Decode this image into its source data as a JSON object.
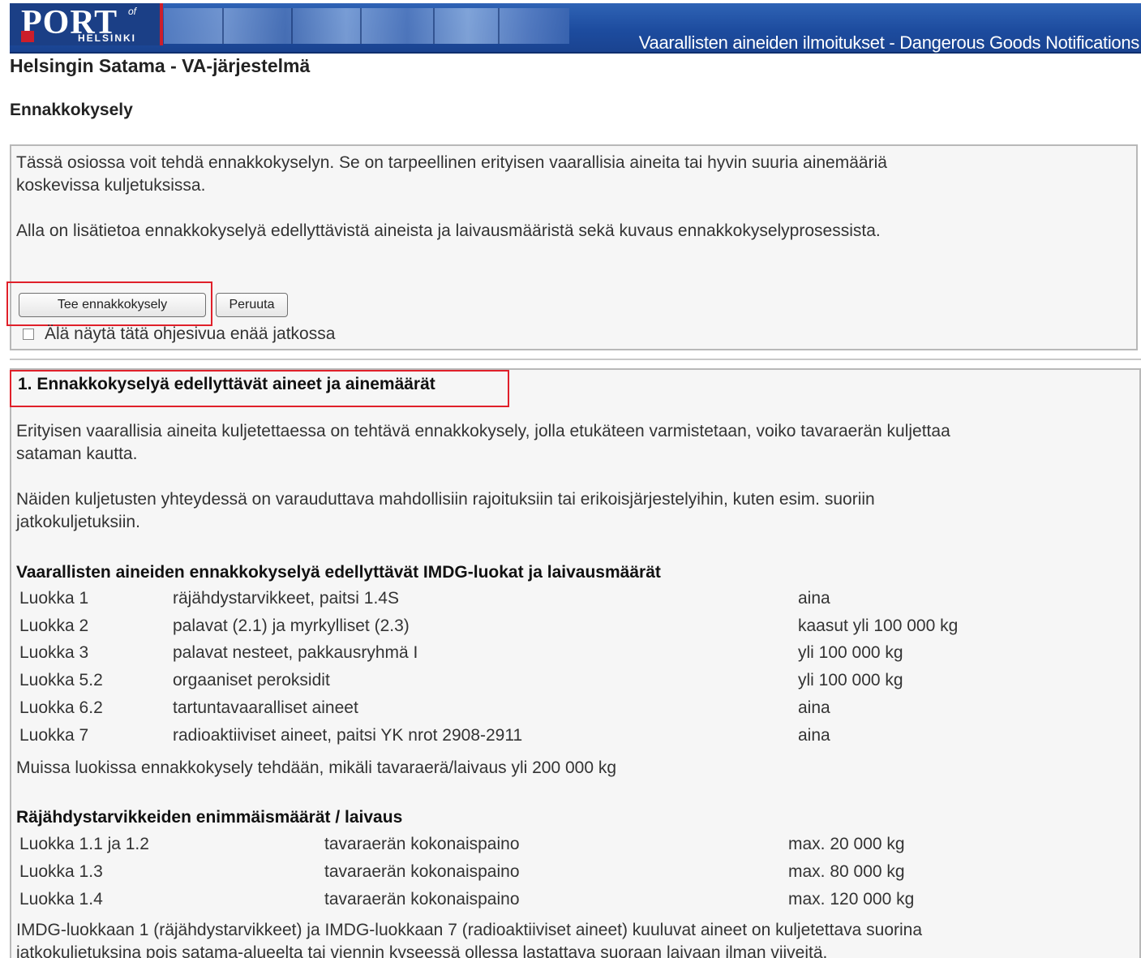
{
  "header": {
    "logo_main": "PORT",
    "logo_of": "of",
    "logo_city": "HELSINKI",
    "title": "Vaarallisten aineiden ilmoitukset - Dangerous Goods Notifications"
  },
  "app_title": "Helsingin Satama - VA-järjestelmä",
  "page_title": "Ennakkokysely",
  "intro": {
    "para1_line1": "Tässä osiossa voit tehdä ennakkokyselyn. Se on tarpeellinen erityisen vaarallisia aineita tai hyvin suuria ainemääriä",
    "para1_line2": "koskevissa kuljetuksissa.",
    "para2": "Alla on lisätietoa ennakkokyselyä edellyttävistä aineista ja laivausmääristä sekä kuvaus ennakkokyselyprosessista.",
    "submit_label": "Tee ennakkokysely",
    "cancel_label": "Peruuta",
    "checkbox_label": "Älä näytä tätä ohjesivua enää jatkossa",
    "checkbox_checked": false
  },
  "section1": {
    "heading": "1. Ennakkokyselyä edellyttävät aineet ja ainemäärät",
    "para1_line1": "Erityisen vaarallisia aineita kuljetettaessa on tehtävä ennakkokysely, jolla etukäteen varmistetaan, voiko tavaraerän kuljettaa",
    "para1_line2": "sataman kautta.",
    "para2_line1": "Näiden kuljetusten yhteydessä on varauduttava mahdollisiin rajoituksiin tai erikoisjärjestelyihin, kuten esim. suoriin",
    "para2_line2": "jatkokuljetuksiin.",
    "table1_heading": "Vaarallisten aineiden ennakkokyselyä edellyttävät IMDG-luokat ja laivausmäärät",
    "table1_rows": [
      [
        "Luokka 1",
        "räjähdystarvikkeet, paitsi 1.4S",
        "aina"
      ],
      [
        "Luokka 2",
        "palavat (2.1) ja myrkylliset (2.3)",
        "kaasut yli 100 000 kg"
      ],
      [
        "Luokka 3",
        "palavat nesteet, pakkausryhmä I",
        "yli 100 000 kg"
      ],
      [
        "Luokka 5.2",
        "orgaaniset peroksidit",
        "yli 100 000 kg"
      ],
      [
        "Luokka 6.2",
        "tartuntavaaralliset aineet",
        "aina"
      ],
      [
        "Luokka 7",
        "radioaktiiviset aineet, paitsi YK nrot 2908-2911",
        "aina"
      ]
    ],
    "table1_note": "Muissa luokissa ennakkokysely tehdään, mikäli tavaraerä/laivaus yli 200 000 kg",
    "table2_heading": "Räjähdystarvikkeiden enimmäismäärät / laivaus",
    "table2_rows": [
      [
        "Luokka 1.1 ja 1.2",
        "tavaraerän kokonaispaino",
        "max. 20 000 kg"
      ],
      [
        "Luokka 1.3",
        "tavaraerän kokonaispaino",
        "max. 80 000 kg"
      ],
      [
        "Luokka 1.4",
        "tavaraerän kokonaispaino",
        "max. 120 000 kg"
      ]
    ],
    "footer_line1": "IMDG-luokkaan 1 (räjähdystarvikkeet) ja IMDG-luokkaan 7 (radioaktiiviset aineet) kuuluvat aineet on kuljetettava suorina",
    "footer_line2": "jatkokuljetuksina pois satama-alueelta tai viennin kyseessä ollessa lastattava suoraan laivaan ilman viiveitä."
  },
  "colors": {
    "header_blue": "#1d4c9f",
    "highlight_red": "#e0202a",
    "panel_bg": "#f6f6f6"
  }
}
